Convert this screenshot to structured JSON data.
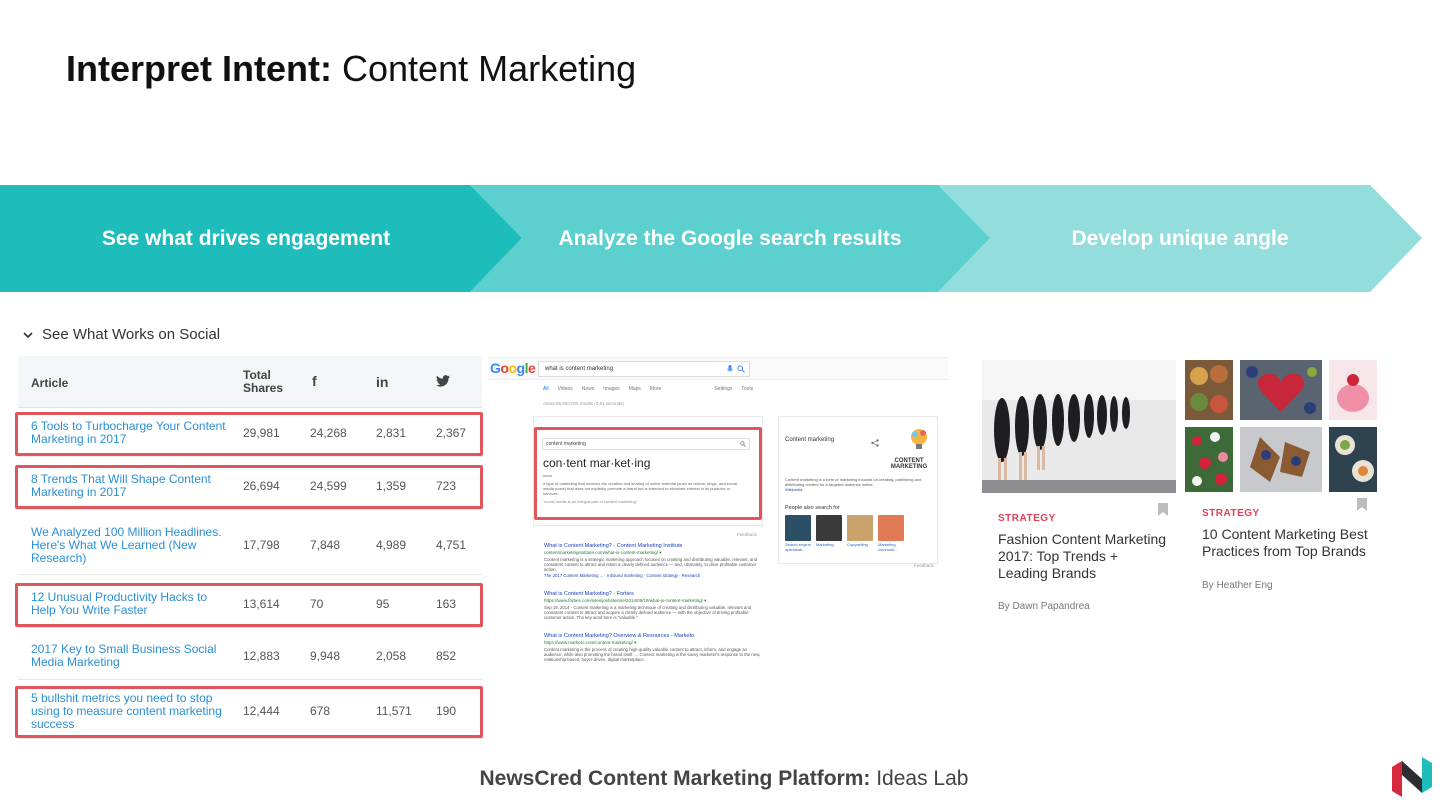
{
  "title": {
    "bold": "Interpret Intent:",
    "rest": " Content Marketing"
  },
  "steps": [
    "See what drives engagement",
    "Analyze the Google search results",
    "Develop unique angle"
  ],
  "social": {
    "heading": "See What Works on Social",
    "columns": {
      "article": "Article",
      "total": "Total Shares",
      "fb": "f",
      "li": "in"
    },
    "rows": [
      {
        "article": "6 Tools to Turbocharge Your Content Marketing in 2017",
        "total": "29,981",
        "fb": "24,268",
        "li": "2,831",
        "tw": "2,367",
        "highlight": true
      },
      {
        "article": "8 Trends That Will Shape Content Marketing in 2017",
        "total": "26,694",
        "fb": "24,599",
        "li": "1,359",
        "tw": "723",
        "highlight": true
      },
      {
        "article": "We Analyzed 100 Million Headlines. Here's What We Learned (New Research)",
        "total": "17,798",
        "fb": "7,848",
        "li": "4,989",
        "tw": "4,751",
        "highlight": false
      },
      {
        "article": "12 Unusual Productivity Hacks to Help You Write Faster",
        "total": "13,614",
        "fb": "70",
        "li": "95",
        "tw": "163",
        "highlight": true
      },
      {
        "article": "2017 Key to Small Business Social Media Marketing",
        "total": "12,883",
        "fb": "9,948",
        "li": "2,058",
        "tw": "852",
        "highlight": false
      },
      {
        "article": "5 bullshit metrics you need to stop using to measure content marketing success",
        "total": "12,444",
        "fb": "678",
        "li": "11,571",
        "tw": "190",
        "highlight": true
      }
    ]
  },
  "google": {
    "logo": "Google",
    "query": "what is content marketing",
    "tabs": [
      "All",
      "Videos",
      "News",
      "Images",
      "Maps",
      "More",
      "Settings",
      "Tools"
    ],
    "count": "About 56,800,000 results (0.61 seconds)",
    "dict_query": "content marketing",
    "dict_word": "con·tent mar·ket·ing",
    "dict_pos": "noun",
    "dict_def": "a type of marketing that involves the creation and sharing of online material (such as videos, blogs, and social media posts) that does not explicitly promote a brand but is intended to stimulate interest in its products or services.",
    "dict_example": "\"social media is an integral part of content marketing\"",
    "feedback": "Feedback",
    "kp_title": "Content marketing",
    "kp_logo_text": "CONTENT MARKETING",
    "kp_text": "Content marketing is a form of marketing focused on creating, publishing and distributing content for a targeted audience online.",
    "kp_source": "Wikipedia",
    "kp_also": "People also search for",
    "kp_thumbs": [
      "Search engine optimizati...",
      "Marketing",
      "Copywriting",
      "Marketing communi..."
    ],
    "results": [
      {
        "title": "What is Content Marketing? - Content Marketing Institute",
        "url": "contentmarketinginstitute.com/what-is-content-marketing/ ▾",
        "snippet": "Content marketing is a strategic marketing approach focused on creating and distributing valuable, relevant, and consistent content to attract and retain a clearly defined audience — and, ultimately, to drive profitable customer action.",
        "links": "The 2017 Content Marketing ... · Inbound marketing · Content strategy · Research"
      },
      {
        "title": "What is Content Marketing? - Forbes",
        "url": "https://www.forbes.com/sites/joshsteimle/2014/09/19/what-is-content-marketing/ ▾",
        "snippet": "Sep 19, 2014 - Content marketing is a marketing technique of creating and distributing valuable, relevant and consistent content to attract and acquire a clearly defined audience — with the objective of driving profitable customer action. The key word here is \"valuable.\"",
        "links": ""
      },
      {
        "title": "What is Content Marketing? Overview & Resources - Marketo",
        "url": "https://www.marketo.com/content-marketing/ ▾",
        "snippet": "Content marketing is the process of creating high-quality valuable content to attract, inform, and engage an audience, while also promoting the brand itself. ... Content marketing is the savvy marketer's response to the new, relationship-based, buyer-driven, digital marketplace.",
        "links": ""
      }
    ]
  },
  "articles": [
    {
      "category": "STRATEGY",
      "title": "Fashion Content Marketing 2017: Top Trends + Leading Brands",
      "byline": "By Dawn Papandrea"
    },
    {
      "category": "STRATEGY",
      "title": "10 Content Marketing Best Practices from Top Brands",
      "byline": "By Heather Eng"
    }
  ],
  "footer": {
    "bold": "NewsCred Content Marketing Platform:",
    "rest": " Ideas Lab"
  },
  "colors": {
    "teal1": "#1fbcbc",
    "teal2": "#5ccfcf",
    "teal3": "#93dddd",
    "highlight": "#e0565f",
    "link": "#2a8fd6",
    "category": "#e0425a"
  }
}
